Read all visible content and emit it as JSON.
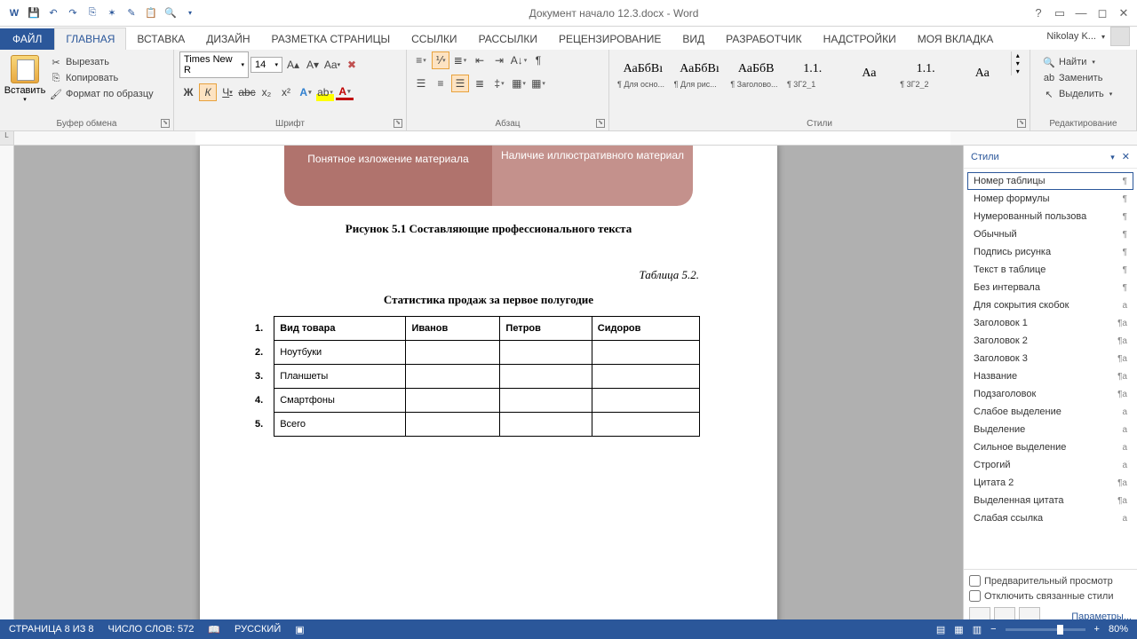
{
  "title": "Документ начало 12.3.docx - Word",
  "user": "Nikolay K...",
  "menu": {
    "file": "ФАЙЛ",
    "tabs": [
      "ГЛАВНАЯ",
      "ВСТАВКА",
      "ДИЗАЙН",
      "РАЗМЕТКА СТРАНИЦЫ",
      "ССЫЛКИ",
      "РАССЫЛКИ",
      "РЕЦЕНЗИРОВАНИЕ",
      "ВИД",
      "РАЗРАБОТЧИК",
      "НАДСТРОЙКИ",
      "МОЯ ВКЛАДКА"
    ]
  },
  "clip": {
    "paste": "Вставить",
    "cut": "Вырезать",
    "copy": "Копировать",
    "format": "Формат по образцу",
    "label": "Буфер обмена"
  },
  "font": {
    "name": "Times New R",
    "size": "14",
    "label": "Шрифт"
  },
  "para": {
    "label": "Абзац"
  },
  "styles": {
    "label": "Стили",
    "items": [
      {
        "prev": "АаБбВı",
        "name": "¶ Для осно..."
      },
      {
        "prev": "АаБбВı",
        "name": "¶ Для рис..."
      },
      {
        "prev": "АаБбВ",
        "name": "¶ Заголово..."
      },
      {
        "prev": "1.1.",
        "name": "¶ 3Г2_1"
      },
      {
        "prev": "Аа",
        "name": ""
      },
      {
        "prev": "1.1.",
        "name": "¶ 3Г2_2"
      },
      {
        "prev": "Аа",
        "name": ""
      }
    ]
  },
  "editing": {
    "find": "Найти",
    "replace": "Заменить",
    "select": "Выделить",
    "label": "Редактирование"
  },
  "doc": {
    "sa_left": "Понятное изложение материала",
    "sa_right": "Наличие иллюстративного материал",
    "caption": "Рисунок 5.1 Составляющие профессионального текста",
    "tbl_label": "Таблица 5.2.",
    "tbl_title": "Статистика продаж за первое полугодие",
    "nums": [
      "1.",
      "2.",
      "3.",
      "4.",
      "5."
    ],
    "headers": [
      "Вид товара",
      "Иванов",
      "Петров",
      "Сидоров"
    ],
    "rows": [
      "Ноутбуки",
      "Планшеты",
      "Смартфоны",
      "Всего"
    ]
  },
  "pane": {
    "title": "Стили",
    "items": [
      {
        "n": "Номер таблицы",
        "m": "¶",
        "sel": true
      },
      {
        "n": "Номер формулы",
        "m": "¶"
      },
      {
        "n": "Нумерованный пользова",
        "m": "¶"
      },
      {
        "n": "Обычный",
        "m": "¶"
      },
      {
        "n": "Подпись рисунка",
        "m": "¶"
      },
      {
        "n": "Текст в таблице",
        "m": "¶"
      },
      {
        "n": "Без интервала",
        "m": "¶"
      },
      {
        "n": "Для сокрытия скобок",
        "m": "a"
      },
      {
        "n": "Заголовок 1",
        "m": "¶a"
      },
      {
        "n": "Заголовок 2",
        "m": "¶a"
      },
      {
        "n": "Заголовок 3",
        "m": "¶a"
      },
      {
        "n": "Название",
        "m": "¶a"
      },
      {
        "n": "Подзаголовок",
        "m": "¶a"
      },
      {
        "n": "Слабое выделение",
        "m": "a"
      },
      {
        "n": "Выделение",
        "m": "a"
      },
      {
        "n": "Сильное выделение",
        "m": "a"
      },
      {
        "n": "Строгий",
        "m": "a"
      },
      {
        "n": "Цитата 2",
        "m": "¶a"
      },
      {
        "n": "Выделенная цитата",
        "m": "¶a"
      },
      {
        "n": "Слабая ссылка",
        "m": "a"
      }
    ],
    "preview": "Предварительный просмотр",
    "disable": "Отключить связанные стили",
    "params": "Параметры..."
  },
  "status": {
    "page": "СТРАНИЦА 8 ИЗ 8",
    "words": "ЧИСЛО СЛОВ: 572",
    "lang": "РУССКИЙ",
    "zoom": "80%"
  }
}
